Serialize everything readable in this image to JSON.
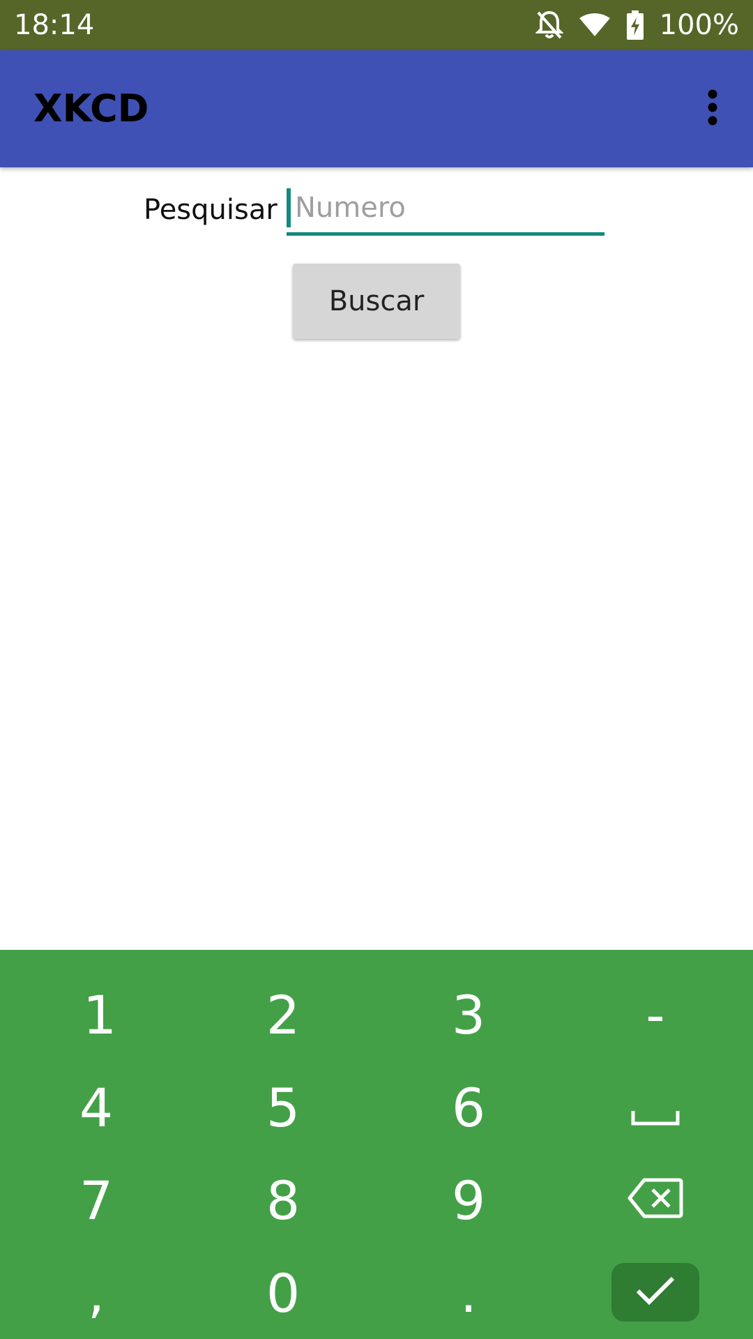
{
  "status_bar": {
    "time": "18:14",
    "battery_percent": "100%",
    "icons": [
      "notifications-off-icon",
      "wifi-icon",
      "battery-charging-icon"
    ]
  },
  "app_bar": {
    "title": "XKCD",
    "overflow_icon": "more-vert-icon"
  },
  "search": {
    "label": "Pesquisar",
    "value": "",
    "placeholder": "Numero",
    "button_label": "Buscar"
  },
  "keyboard": {
    "keys": [
      "1",
      "2",
      "3",
      "-",
      "4",
      "5",
      "6",
      "space",
      "7",
      "8",
      "9",
      "backspace",
      ",",
      "0",
      ".",
      "enter"
    ],
    "key_labels": {
      "k1": "1",
      "k2": "2",
      "k3": "3",
      "dash": "-",
      "k4": "4",
      "k5": "5",
      "k6": "6",
      "k7": "7",
      "k8": "8",
      "k9": "9",
      "comma": ",",
      "k0": "0",
      "period": "."
    }
  },
  "colors": {
    "status_bar": "#556628",
    "app_bar": "#3f51b5",
    "accent": "#14897c",
    "button": "#d6d6d6",
    "keyboard": "#43a047",
    "enter_key": "#2e7d32"
  }
}
